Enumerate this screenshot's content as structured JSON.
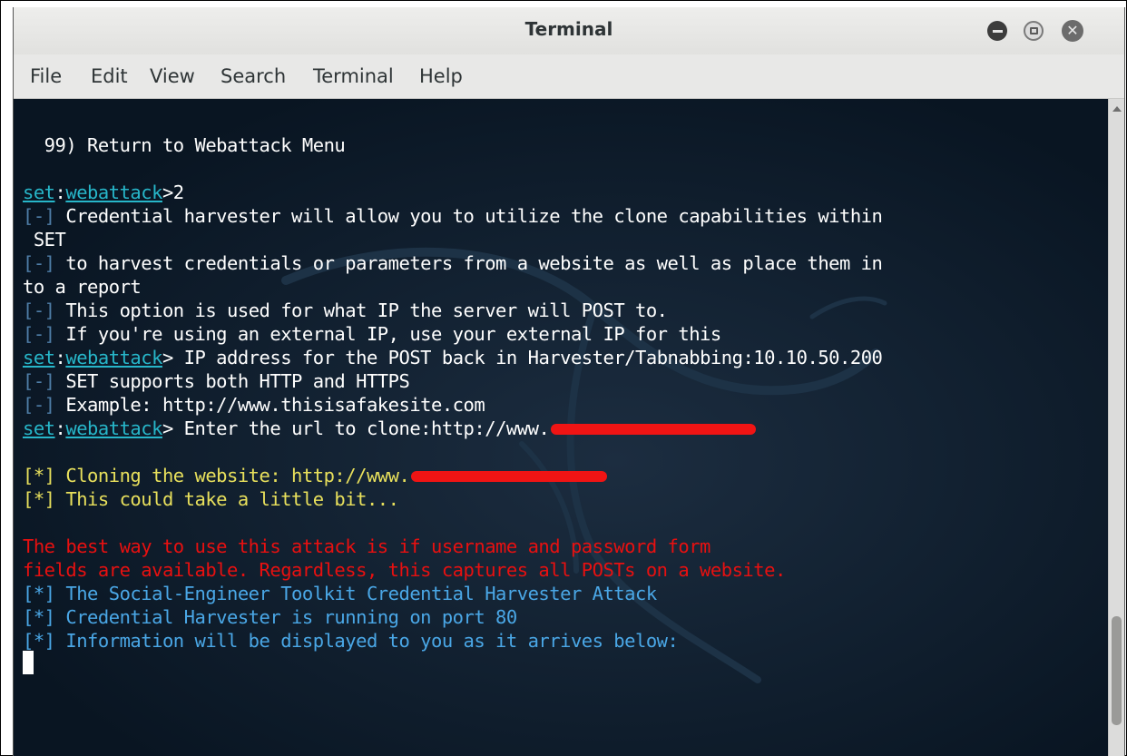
{
  "window": {
    "title": "Terminal",
    "controls": {
      "minimize": "minimize-icon",
      "maximize": "maximize-icon",
      "close": "close-icon"
    }
  },
  "menu": [
    "File",
    "Edit",
    "View",
    "Search",
    "Terminal",
    "Help"
  ],
  "colors": {
    "terminal_bg": "#0b1726",
    "prompt": "#27b6c9",
    "info": "#4f7ea8",
    "status": "#e8e05c",
    "warning": "#e81010",
    "redaction": "#f01414"
  },
  "terminal": {
    "menu_return": "  99) Return to Webattack Menu",
    "prompt_set": "set",
    "prompt_webattack": "webattack",
    "l1_cmd": ">2",
    "l2_tag": "[-]",
    "l2_text": " Credential harvester will allow you to utilize the clone capabilities within",
    "l3_text": " SET",
    "l4_tag": "[-]",
    "l4_text": " to harvest credentials or parameters from a website as well as place them in",
    "l5_text": "to a report",
    "l6_tag": "[-]",
    "l6_text": " This option is used for what IP the server will POST to.",
    "l7_tag": "[-]",
    "l7_text": " If you're using an external IP, use your external IP for this",
    "l8_text": "> IP address for the POST back in Harvester/Tabnabbing:10.10.50.200",
    "l9_tag": "[-]",
    "l9_text": " SET supports both HTTP and HTTPS",
    "l10_tag": "[-]",
    "l10_text": " Example: http://www.thisisafakesite.com",
    "l11_text": "> Enter the url to clone:http://www.",
    "l12_text": "[*] Cloning the website: http://www.",
    "l13_text": "[*] This could take a little bit...",
    "l14_text": "The best way to use this attack is if username and password form",
    "l15_text": "fields are available. Regardless, this captures all POSTs on a website.",
    "l16_text": "[*] The Social-Engineer Toolkit Credential Harvester Attack",
    "l17_text": "[*] Credential Harvester is running on port 80",
    "l18_text": "[*] Information will be displayed to you as it arrives below:"
  }
}
